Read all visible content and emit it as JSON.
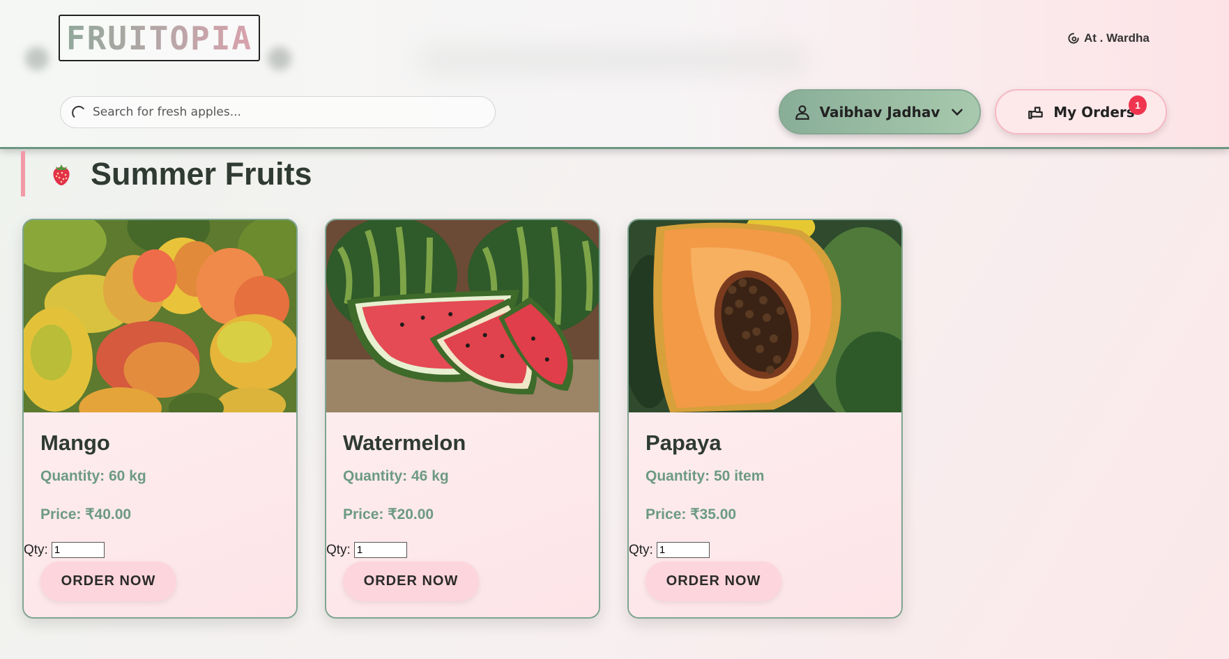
{
  "header": {
    "logo_text": "FRUITOPIA",
    "location": "At . Wardha",
    "search_placeholder": "Search for fresh apples...",
    "user_name": "Vaibhav Jadhav",
    "orders_label": "My Orders",
    "orders_count": "1"
  },
  "section": {
    "title": "Summer Fruits",
    "icon": "strawberry-icon"
  },
  "products": [
    {
      "name": "Mango",
      "quantity": "Quantity: 60 kg",
      "price": "Price: ₹40.00",
      "qty_label": "Qty:",
      "qty_value": "1",
      "order_label": "ORDER NOW"
    },
    {
      "name": "Watermelon",
      "quantity": "Quantity: 46 kg",
      "price": "Price: ₹20.00",
      "qty_label": "Qty:",
      "qty_value": "1",
      "order_label": "ORDER NOW"
    },
    {
      "name": "Papaya",
      "quantity": "Quantity: 50 item",
      "price": "Price: ₹35.00",
      "qty_label": "Qty:",
      "qty_value": "1",
      "order_label": "ORDER NOW"
    }
  ],
  "colors": {
    "accent_green": "#6c9a82",
    "accent_pink": "#f39aa8",
    "badge_red": "#f0344f"
  }
}
